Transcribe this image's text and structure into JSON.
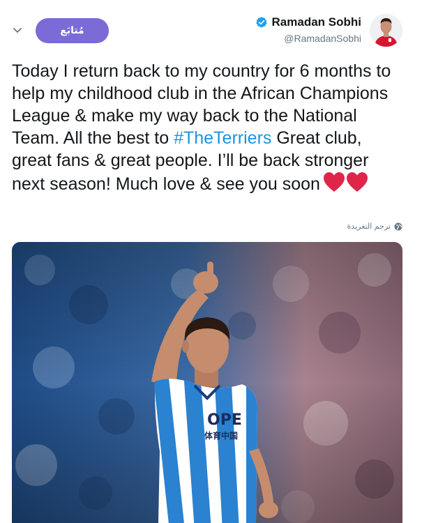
{
  "header": {
    "follow_label": "مُتابَع",
    "display_name": "Ramadan Sobhi",
    "handle": "@RamadanSobhi",
    "verified": true,
    "icons": {
      "menu": "chevron-down-icon",
      "verified": "verified-badge-icon"
    }
  },
  "tweet": {
    "text_before": "Today I return back to my country for 6 months to help my childhood club in the African Champions League & make my way back to the National Team. All the best to ",
    "hashtag": "#TheTerriers",
    "text_after": " Great club, great fans & great people. I’ll be back stronger next season! Much love & see you soon",
    "emojis": [
      "heart",
      "heart"
    ]
  },
  "translate": {
    "label": "ترجم التغريدة",
    "icon": "globe-icon"
  },
  "media": {
    "shirt_text": "OPE",
    "shirt_sub": "体育中国"
  },
  "colors": {
    "accent": "#1b95e0",
    "follow_bg": "#7b6bd6",
    "verified": "#1da1f2",
    "text": "#14171a",
    "muted": "#657786",
    "heart": "#e0254a"
  }
}
